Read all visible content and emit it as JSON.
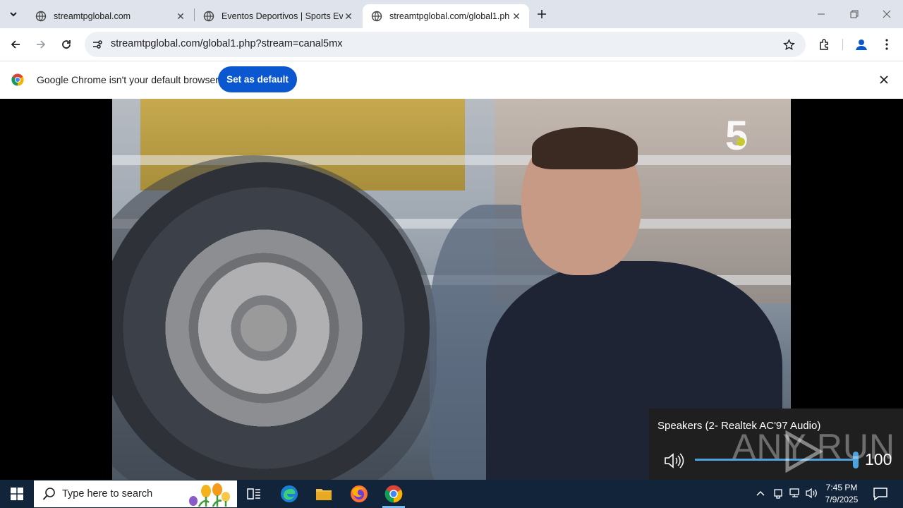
{
  "browser": {
    "tabs": [
      {
        "title": "streamtpglobal.com",
        "active": false
      },
      {
        "title": "Eventos Deportivos | Sports Eve",
        "active": false
      },
      {
        "title": "streamtpglobal.com/global1.ph",
        "active": true
      }
    ],
    "address_bar": {
      "url": "streamtpglobal.com/global1.php?stream=canal5mx"
    },
    "infobar": {
      "message": "Google Chrome isn't your default browser",
      "button_label": "Set as default"
    }
  },
  "video": {
    "channel_logo_text": "5"
  },
  "volume_flyout": {
    "device_label": "Speakers (2- Realtek AC'97 Audio)",
    "level": 100,
    "level_text": "100"
  },
  "watermark": {
    "text": "ANY   RUN"
  },
  "taskbar": {
    "search_placeholder": "Type here to search",
    "clock_time": "7:45 PM",
    "clock_date": "7/9/2025",
    "pinned_apps": [
      "task-view",
      "edge",
      "file-explorer",
      "firefox",
      "chrome"
    ]
  },
  "colors": {
    "tabstrip_bg": "#dfe3eb",
    "accent_button": "#0b57d0",
    "taskbar_bg": "#11243a",
    "volume_accent": "#4aa3df"
  },
  "icons": [
    "tab-search-icon",
    "globe-icon",
    "close-icon",
    "plus-icon",
    "minimize-icon",
    "restore-icon",
    "back-icon",
    "forward-icon",
    "reload-icon",
    "site-info-icon",
    "bookmark-star-icon",
    "extensions-icon",
    "profile-icon",
    "kebab-menu-icon",
    "chrome-logo-icon",
    "speaker-icon",
    "windows-logo-icon",
    "search-icon"
  ]
}
